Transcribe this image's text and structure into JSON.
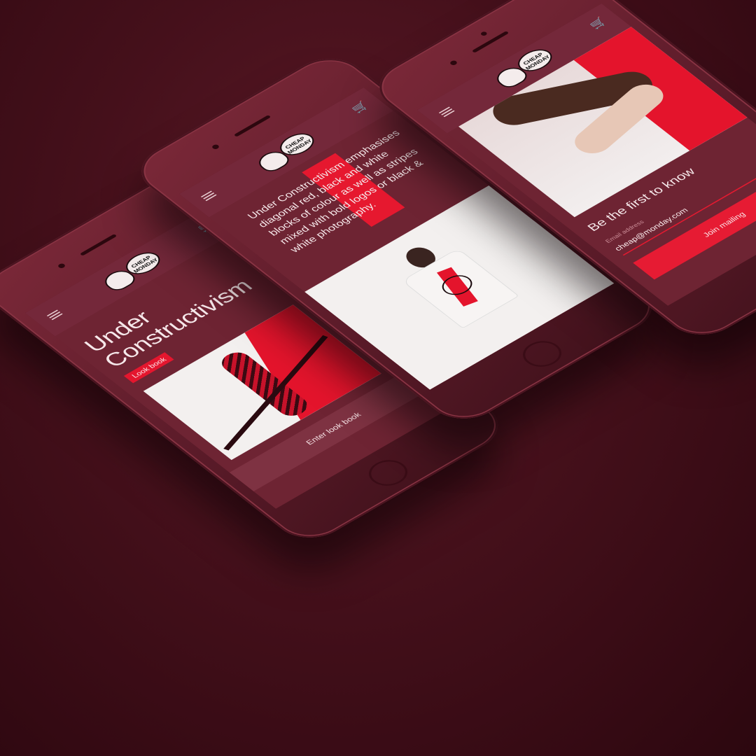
{
  "brand": {
    "logo_text": "CHEAP MONDAY"
  },
  "phone_left": {
    "headline_line1": "Under",
    "headline_line2": "Constructivism",
    "pill_label": "Look book",
    "button_label": "Enter look book"
  },
  "phone_center": {
    "paragraph": "Under Constructivism emphasises diagonal red, black and white blocks of colour as well as stripes mixed with bold logos or black & white photography."
  },
  "phone_right": {
    "title": "Be the first to know",
    "email_label": "Email address",
    "email_value": "cheap@monday.com",
    "button_label": "Join mailing"
  },
  "colors": {
    "accent": "#e4162e",
    "background": "#45101b",
    "screen": "#6e2433"
  },
  "icons": [
    "menu-icon",
    "cart-icon"
  ]
}
